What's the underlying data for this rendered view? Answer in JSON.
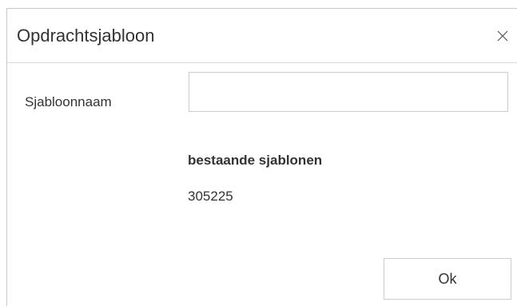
{
  "dialog": {
    "title": "Opdrachtsjabloon",
    "close_icon": "close-icon",
    "fields": {
      "template_name_label": "Sjabloonnaam",
      "template_name_value": ""
    },
    "existing": {
      "heading": "bestaande sjablonen",
      "items": [
        "305225"
      ]
    },
    "ok_label": "Ok"
  },
  "colors": {
    "text": "#333333",
    "border": "#cccccc",
    "background": "#ffffff"
  }
}
